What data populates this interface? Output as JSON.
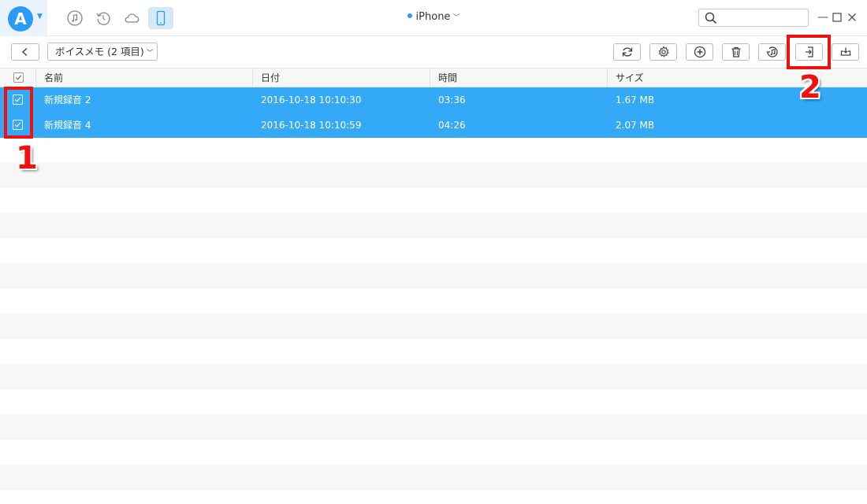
{
  "titlebar": {
    "logo_letter": "A",
    "device_name": "iPhone",
    "search_placeholder": "",
    "window_controls": [
      "minimize-icon",
      "maximize-icon",
      "close-icon"
    ],
    "mode_icons": [
      "music-icon",
      "restore-icon",
      "cloud-icon",
      "phone-icon"
    ],
    "active_mode": "phone-icon"
  },
  "toolbar": {
    "category_label": "ボイスメモ (2 項目)",
    "tools": [
      "refresh-icon",
      "settings-icon",
      "add-icon",
      "delete-icon",
      "to-itunes-icon",
      "to-computer-icon",
      "to-device-icon"
    ]
  },
  "table": {
    "columns": [
      "名前",
      "日付",
      "時間",
      "サイズ"
    ],
    "rows": [
      {
        "name": "新規録音 2",
        "date": "2016-10-18 10:10:30",
        "duration": "03:36",
        "size": "1.67 MB",
        "selected": true
      },
      {
        "name": "新規録音 4",
        "date": "2016-10-18 10:10:59",
        "duration": "04:26",
        "size": "2.07 MB",
        "selected": true
      }
    ]
  },
  "annotations": {
    "step1": "1",
    "step2": "2",
    "color": "#ef1010"
  },
  "colors": {
    "accent": "#2a9cf3",
    "selection": "#34a9f7"
  }
}
